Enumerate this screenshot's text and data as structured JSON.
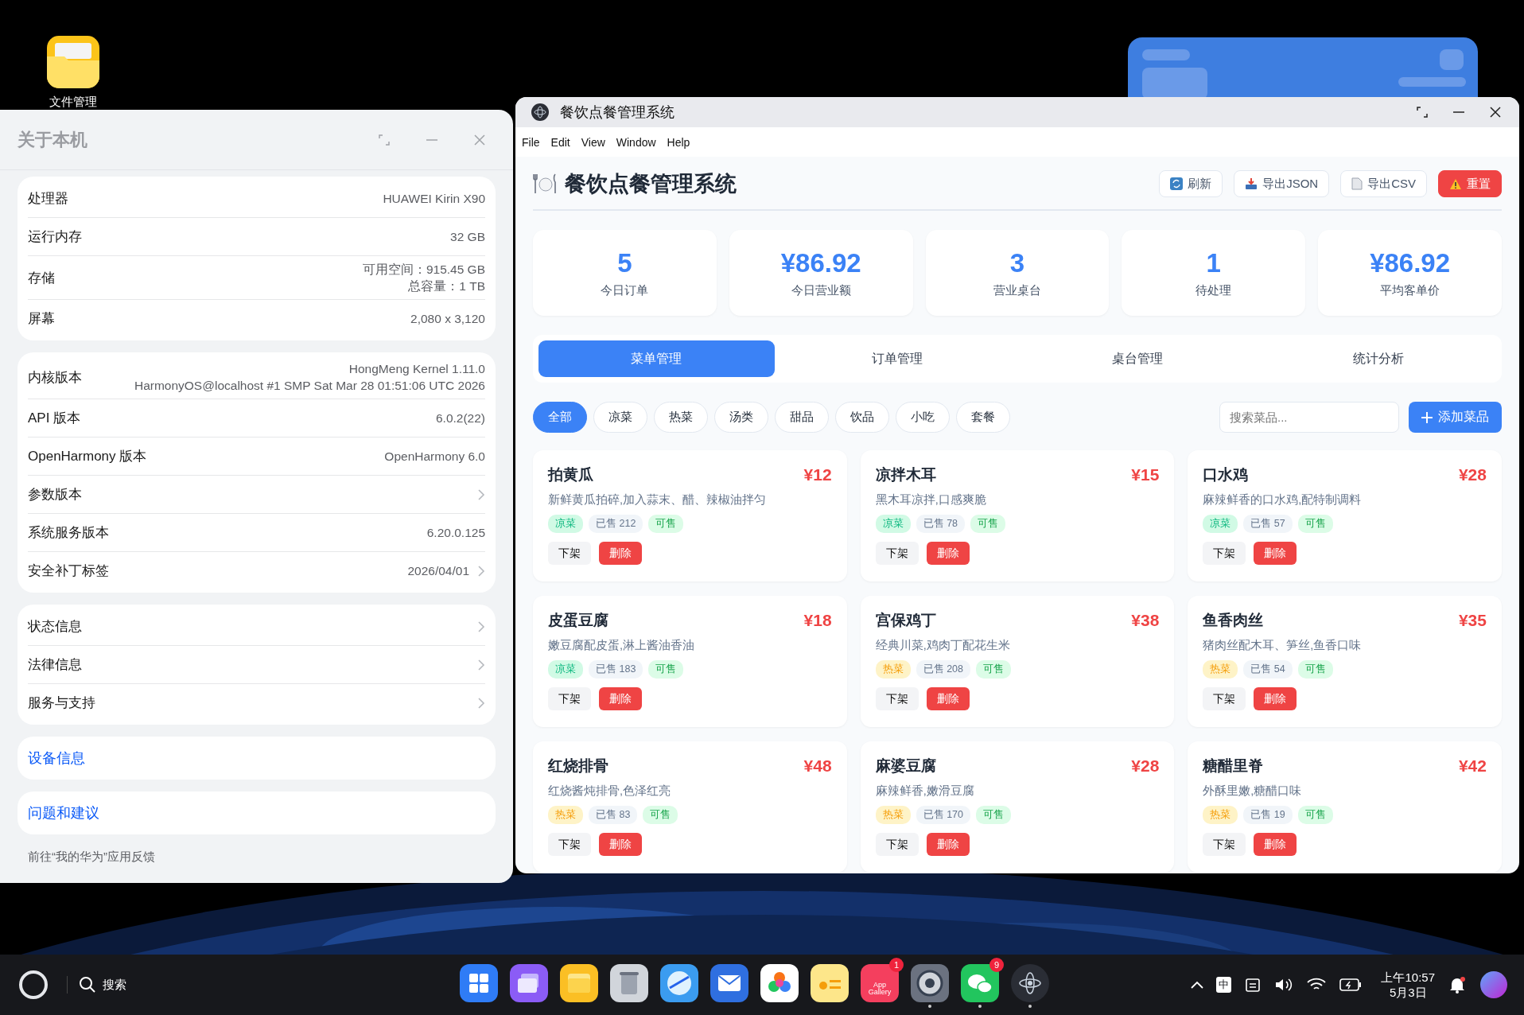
{
  "desktop": {
    "icons": [
      {
        "label": "文件管理"
      }
    ]
  },
  "about_window": {
    "title": "关于本机",
    "groups": [
      [
        {
          "label": "处理器",
          "values": [
            "HUAWEI Kirin X90"
          ],
          "chevron": false
        },
        {
          "label": "运行内存",
          "values": [
            "32 GB"
          ],
          "chevron": false
        },
        {
          "label": "存储",
          "values": [
            "可用空间：915.45 GB",
            "总容量：1 TB"
          ],
          "chevron": false
        },
        {
          "label": "屏幕",
          "values": [
            "2,080 x 3,120"
          ],
          "chevron": false
        }
      ],
      [
        {
          "label": "内核版本",
          "values": [
            "HongMeng Kernel 1.11.0",
            "HarmonyOS@localhost #1 SMP Sat Mar 28 01:51:06 UTC 2026"
          ],
          "chevron": false
        },
        {
          "label": "API 版本",
          "values": [
            "6.0.2(22)"
          ],
          "chevron": false
        },
        {
          "label": "OpenHarmony 版本",
          "values": [
            "OpenHarmony 6.0"
          ],
          "chevron": false
        },
        {
          "label": "参数版本",
          "chevron": true
        },
        {
          "label": "系统服务版本",
          "values": [
            "6.20.0.125"
          ],
          "chevron": false
        },
        {
          "label": "安全补丁标签",
          "values": [
            "2026/04/01"
          ],
          "chevron": true
        }
      ],
      [
        {
          "label": "状态信息",
          "chevron": true
        },
        {
          "label": "法律信息",
          "chevron": true
        },
        {
          "label": "服务与支持",
          "chevron": true
        }
      ]
    ],
    "links": [
      "设备信息",
      "问题和建议"
    ],
    "footnote": "前往“我的华为”应用反馈"
  },
  "app_window": {
    "title": "餐饮点餐管理系统",
    "menu": [
      "File",
      "Edit",
      "View",
      "Window",
      "Help"
    ],
    "heading": "餐饮点餐管理系统",
    "actions": [
      {
        "label": "刷新",
        "kind": "refresh"
      },
      {
        "label": "导出JSON",
        "kind": "download"
      },
      {
        "label": "导出CSV",
        "kind": "file"
      },
      {
        "label": "重置",
        "kind": "reset"
      }
    ],
    "stats": [
      {
        "value": "5",
        "label": "今日订单"
      },
      {
        "value": "¥86.92",
        "label": "今日营业额"
      },
      {
        "value": "3",
        "label": "营业桌台"
      },
      {
        "value": "1",
        "label": "待处理"
      },
      {
        "value": "¥86.92",
        "label": "平均客单价"
      }
    ],
    "tabs": [
      {
        "label": "菜单管理",
        "selected": true
      },
      {
        "label": "订单管理",
        "selected": false
      },
      {
        "label": "桌台管理",
        "selected": false
      },
      {
        "label": "统计分析",
        "selected": false
      }
    ],
    "filters": [
      {
        "label": "全部",
        "selected": true
      },
      {
        "label": "凉菜",
        "selected": false
      },
      {
        "label": "热菜",
        "selected": false
      },
      {
        "label": "汤类",
        "selected": false
      },
      {
        "label": "甜品",
        "selected": false
      },
      {
        "label": "饮品",
        "selected": false
      },
      {
        "label": "小吃",
        "selected": false
      },
      {
        "label": "套餐",
        "selected": false
      }
    ],
    "search": {
      "placeholder": "搜索菜品..."
    },
    "add_button": "添加菜品",
    "dishes": [
      {
        "name": "拍黄瓜",
        "price": "¥12",
        "description": "新鲜黄瓜拍碎,加入蒜末、醋、辣椒油拌匀",
        "category": "凉菜",
        "kind": "cold",
        "sold": "已售 212",
        "status": "可售",
        "buttons": [
          "下架",
          "删除"
        ]
      },
      {
        "name": "凉拌木耳",
        "price": "¥15",
        "description": "黑木耳凉拌,口感爽脆",
        "category": "凉菜",
        "kind": "cold",
        "sold": "已售 78",
        "status": "可售",
        "buttons": [
          "下架",
          "删除"
        ]
      },
      {
        "name": "口水鸡",
        "price": "¥28",
        "description": "麻辣鲜香的口水鸡,配特制调料",
        "category": "凉菜",
        "kind": "cold",
        "sold": "已售 57",
        "status": "可售",
        "buttons": [
          "下架",
          "删除"
        ]
      },
      {
        "name": "皮蛋豆腐",
        "price": "¥18",
        "description": "嫩豆腐配皮蛋,淋上酱油香油",
        "category": "凉菜",
        "kind": "cold",
        "sold": "已售 183",
        "status": "可售",
        "buttons": [
          "下架",
          "删除"
        ]
      },
      {
        "name": "宫保鸡丁",
        "price": "¥38",
        "description": "经典川菜,鸡肉丁配花生米",
        "category": "热菜",
        "kind": "hot",
        "sold": "已售 208",
        "status": "可售",
        "buttons": [
          "下架",
          "删除"
        ]
      },
      {
        "name": "鱼香肉丝",
        "price": "¥35",
        "description": "猪肉丝配木耳、笋丝,鱼香口味",
        "category": "热菜",
        "kind": "hot",
        "sold": "已售 54",
        "status": "可售",
        "buttons": [
          "下架",
          "删除"
        ]
      },
      {
        "name": "红烧排骨",
        "price": "¥48",
        "description": "红烧酱炖排骨,色泽红亮",
        "category": "热菜",
        "kind": "hot",
        "sold": "已售 83",
        "status": "可售",
        "buttons": [
          "下架",
          "删除"
        ]
      },
      {
        "name": "麻婆豆腐",
        "price": "¥28",
        "description": "麻辣鲜香,嫩滑豆腐",
        "category": "热菜",
        "kind": "hot",
        "sold": "已售 170",
        "status": "可售",
        "buttons": [
          "下架",
          "删除"
        ]
      },
      {
        "name": "糖醋里脊",
        "price": "¥42",
        "description": "外酥里嫩,糖醋口味",
        "category": "热菜",
        "kind": "hot",
        "sold": "已售 19",
        "status": "可售",
        "buttons": [
          "下架",
          "删除"
        ]
      }
    ]
  },
  "taskbar": {
    "search_label": "搜索",
    "apps": [
      {
        "kind": "grid",
        "running": false
      },
      {
        "kind": "windows",
        "running": false
      },
      {
        "kind": "folder",
        "running": false
      },
      {
        "kind": "trash",
        "running": false
      },
      {
        "kind": "browser",
        "running": false
      },
      {
        "kind": "mail",
        "running": false
      },
      {
        "kind": "photos",
        "running": false
      },
      {
        "kind": "notes",
        "running": false
      },
      {
        "kind": "store",
        "label": "App Gallery",
        "badge": "1",
        "running": false
      },
      {
        "kind": "settings",
        "running": true
      },
      {
        "kind": "chat",
        "badge": "9",
        "running": true
      },
      {
        "kind": "assistant",
        "running": true
      }
    ],
    "input_method": "中",
    "time": "上午10:57",
    "date": "5月3日"
  }
}
